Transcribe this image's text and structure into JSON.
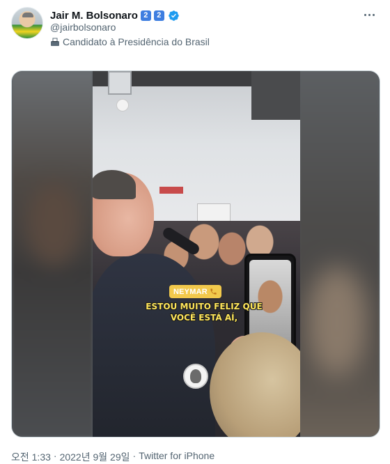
{
  "author": {
    "display_name": "Jair M. Bolsonaro",
    "name_emojis": [
      "2",
      "2"
    ],
    "verified_icon": "verified-badge-icon",
    "handle": "@jairbolsonaro",
    "bio_icon": "ballot-box-icon",
    "bio": "Candidato à Presidência do Brasil"
  },
  "media": {
    "badge_label": "NEYMAR",
    "badge_icon": "phone-icon",
    "caption_line1": "ESTOU MUITO FELIZ QUE",
    "caption_line2": "VOCÊ ESTÁ AÍ,"
  },
  "meta": {
    "time": "오전 1:33",
    "date": "2022년 9월 29일",
    "source": "Twitter for iPhone",
    "separator": "·"
  },
  "colors": {
    "verified_blue": "#1d9bf0",
    "emoji_blue": "#3e7ee0",
    "caption_yellow": "#ffe65a",
    "badge_yellow": "#f2c94c",
    "secondary_text": "#536471"
  }
}
